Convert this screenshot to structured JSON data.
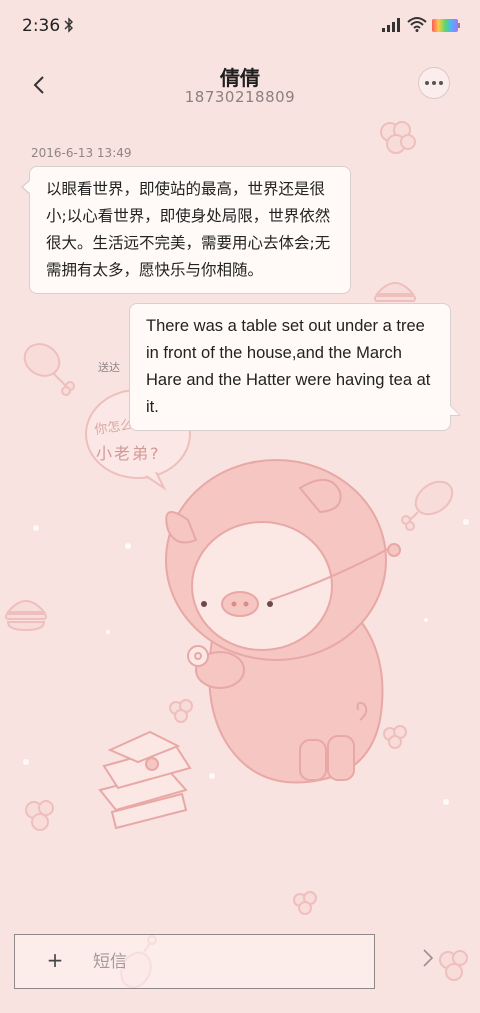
{
  "status_bar": {
    "time": "2:36",
    "icons": [
      "bluetooth-icon",
      "signal-icon",
      "wifi-icon",
      "battery-icon"
    ]
  },
  "header": {
    "contact_name": "倩倩",
    "contact_number": "18730218809",
    "back_icon": "chevron-left-icon",
    "more_icon": "more-horizontal-icon"
  },
  "conversation": {
    "timestamp": "2016-6-13 13:49",
    "incoming_message": "以眼看世界，即使站的最高，世界还是很小;以心看世界，即使身处局限，世界依然很大。生活远不完美，需要用心去体会;无需拥有太多，愿快乐与你相随。",
    "outgoing_message": "There was a table set out under a tree in front of the house,and the March Hare and the Hatter were having tea at it.",
    "delivery_status": "送达"
  },
  "wallpaper": {
    "speech_text_top": "你怎么回事?",
    "speech_text_bottom": "小老弟?"
  },
  "composer": {
    "add_label": "+",
    "placeholder": "短信",
    "send_icon": "chevron-right-icon"
  },
  "colors": {
    "background": "#f9e3e1",
    "bubble_background": "#fffaf8",
    "bubble_border": "#d8cfcf",
    "secondary_text": "#8d8585",
    "pig_pink": "#f5c6c2",
    "pig_outline": "#e8a8a6"
  }
}
